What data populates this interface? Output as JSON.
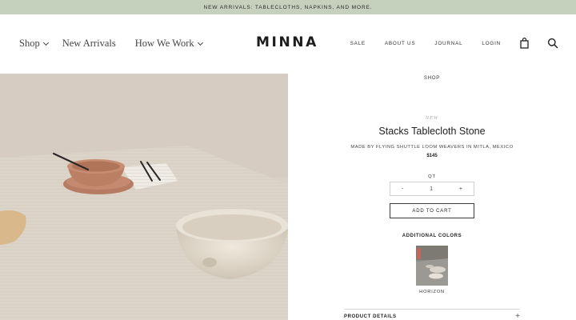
{
  "announcement": "NEW ARRIVALS: TABLECLOTHS, NAPKINS, AND MORE.",
  "nav": {
    "left": [
      {
        "label": "Shop",
        "has_dropdown": true
      },
      {
        "label": "New Arrivals",
        "has_dropdown": false
      },
      {
        "label": "How We Work",
        "has_dropdown": true
      }
    ],
    "logo": "MINNA",
    "right": [
      "SALE",
      "ABOUT US",
      "JOURNAL",
      "LOGIN"
    ],
    "icons": [
      "cart-bag-icon",
      "search-icon"
    ]
  },
  "product": {
    "breadcrumb": "SHOP",
    "badge": "NEW",
    "title": "Stacks Tablecloth Stone",
    "maker": "MADE BY FLYING SHUTTLE LOOM WEAVERS IN MITLA, MEXICO",
    "price": "$145",
    "qty_label": "QT",
    "qty_minus": "-",
    "qty_value": "1",
    "qty_plus": "+",
    "add_to_cart": "ADD TO CART",
    "additional_colors_label": "ADDITIONAL COLORS",
    "colors": [
      {
        "name": "HORIZON"
      }
    ],
    "details_label": "PRODUCT DETAILS",
    "details_toggle": "+"
  },
  "colors": {
    "announcement_bg": "#c5d0bd",
    "text": "#222222",
    "badge": "#a9a9a9",
    "photo_wall": "#d9cfc4",
    "photo_cloth": "#dcd4c8"
  }
}
